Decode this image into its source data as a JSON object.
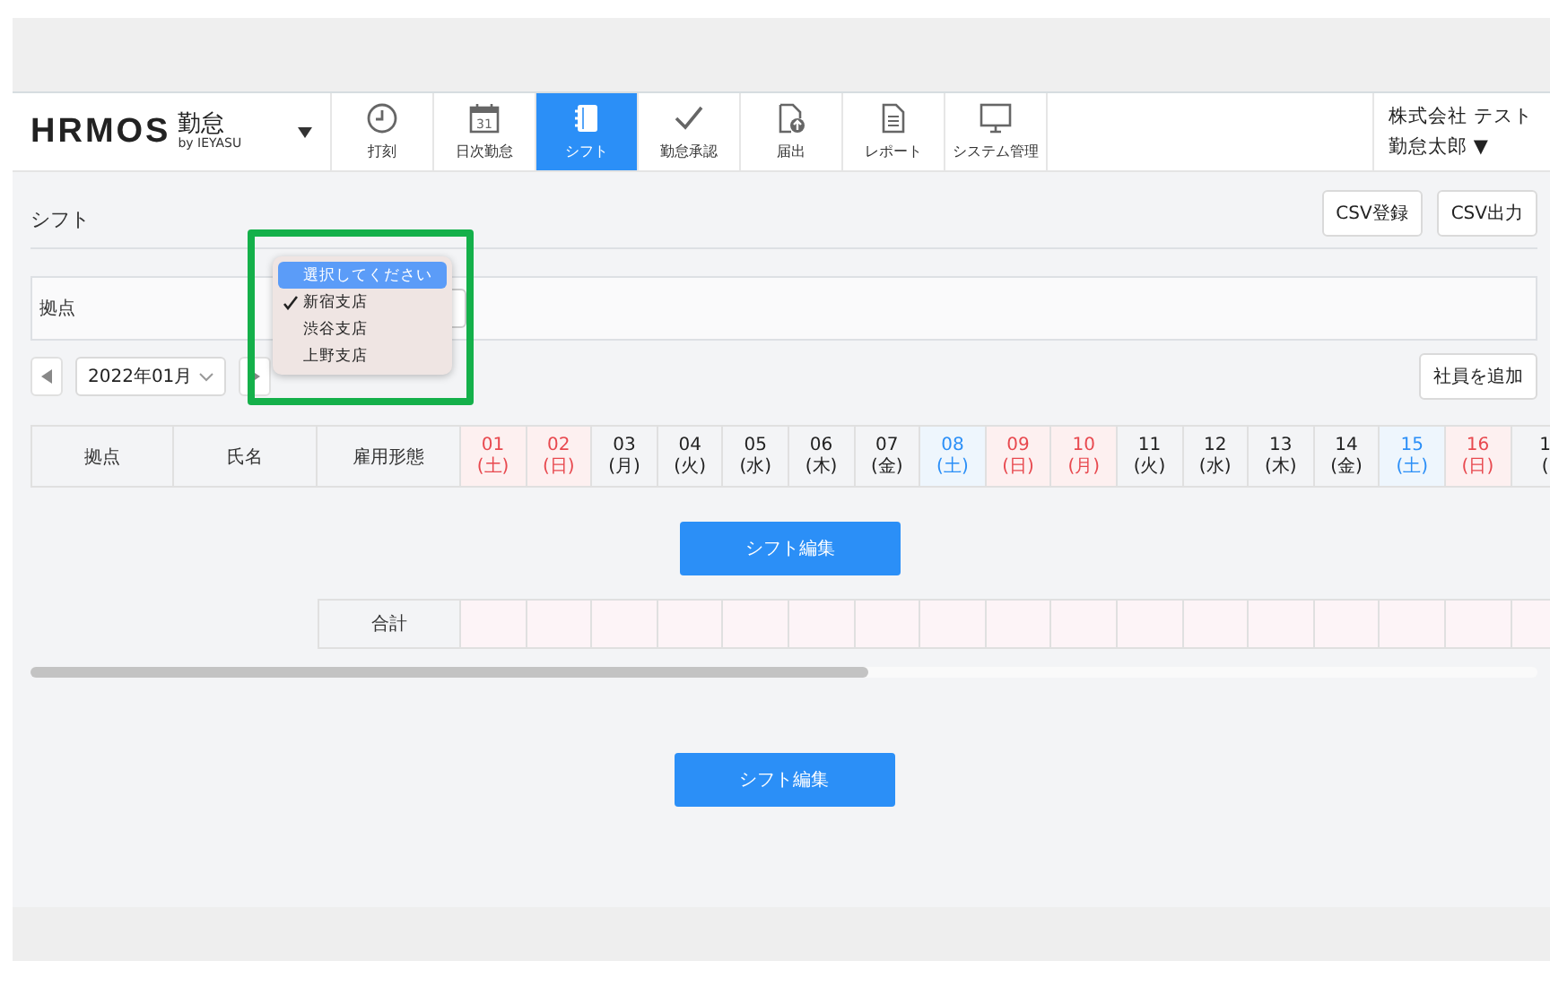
{
  "header": {
    "logo": {
      "wordmark": "HRMOS",
      "product": "勤怠",
      "byline": "by IEYASU"
    },
    "nav": [
      {
        "label": "打刻",
        "kind": "clock",
        "selected": false
      },
      {
        "label": "日次勤怠",
        "kind": "calendar",
        "icon_text": "31",
        "selected": false
      },
      {
        "label": "シフト",
        "kind": "notebook",
        "selected": true
      },
      {
        "label": "勤怠承認",
        "kind": "check",
        "selected": false
      },
      {
        "label": "届出",
        "kind": "upload",
        "selected": false
      },
      {
        "label": "レポート",
        "kind": "document",
        "selected": false
      },
      {
        "label": "システム管理",
        "kind": "monitor",
        "selected": false
      }
    ],
    "user": {
      "company": "株式会社 テスト",
      "name": "勤怠太郎 ▼"
    }
  },
  "page_title": "シフト",
  "top_buttons": [
    "CSV登録",
    "CSV出力"
  ],
  "filter": {
    "label": "拠点"
  },
  "dropdown": [
    {
      "label": "選択してください",
      "selected": true,
      "checked": false
    },
    {
      "label": "新宿支店",
      "selected": false,
      "checked": true
    },
    {
      "label": "渋谷支店",
      "selected": false,
      "checked": false
    },
    {
      "label": "上野支店",
      "selected": false,
      "checked": false
    }
  ],
  "month": "2022年01月",
  "add_button": "社員を追加",
  "table": {
    "columns": [
      "拠点",
      "氏名",
      "雇用形態"
    ],
    "days": [
      {
        "day": "01",
        "weekday": "(土)",
        "kind": "holiday"
      },
      {
        "day": "02",
        "weekday": "(日)",
        "kind": "holiday"
      },
      {
        "day": "03",
        "weekday": "(月)",
        "kind": "weekday"
      },
      {
        "day": "04",
        "weekday": "(火)",
        "kind": "weekday"
      },
      {
        "day": "05",
        "weekday": "(水)",
        "kind": "weekday"
      },
      {
        "day": "06",
        "weekday": "(木)",
        "kind": "weekday"
      },
      {
        "day": "07",
        "weekday": "(金)",
        "kind": "weekday"
      },
      {
        "day": "08",
        "weekday": "(土)",
        "kind": "saturday"
      },
      {
        "day": "09",
        "weekday": "(日)",
        "kind": "holiday"
      },
      {
        "day": "10",
        "weekday": "(月)",
        "kind": "holiday"
      },
      {
        "day": "11",
        "weekday": "(火)",
        "kind": "weekday"
      },
      {
        "day": "12",
        "weekday": "(水)",
        "kind": "weekday"
      },
      {
        "day": "13",
        "weekday": "(木)",
        "kind": "weekday"
      },
      {
        "day": "14",
        "weekday": "(金)",
        "kind": "weekday"
      },
      {
        "day": "15",
        "weekday": "(土)",
        "kind": "saturday"
      },
      {
        "day": "16",
        "weekday": "(日)",
        "kind": "holiday"
      },
      {
        "day": "1",
        "weekday": "(",
        "kind": "weekday"
      }
    ],
    "total_label": "合計"
  },
  "edit_buttons": [
    "シフト編集",
    "シフト編集"
  ]
}
